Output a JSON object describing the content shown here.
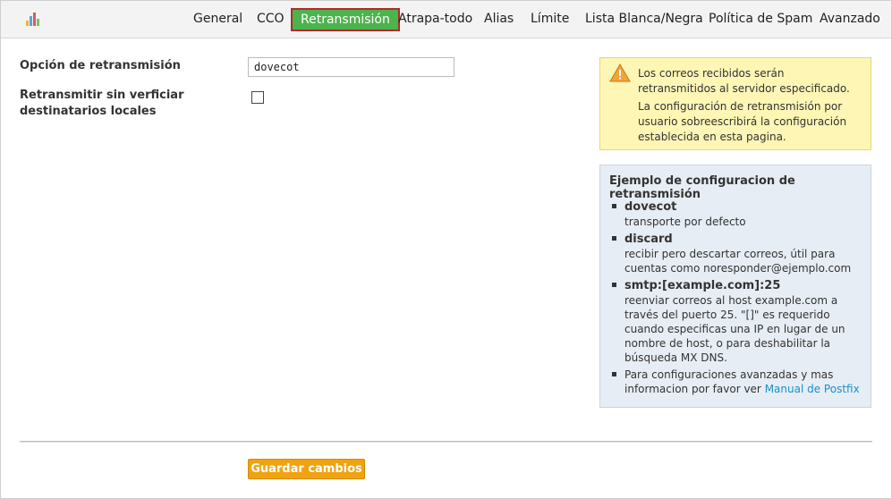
{
  "nav": {
    "tabs": [
      {
        "label": "General"
      },
      {
        "label": "CCO"
      },
      {
        "label": "Retransmisión",
        "active": true
      },
      {
        "label": "Atrapa-todo"
      },
      {
        "label": "Alias"
      },
      {
        "label": "Límite"
      },
      {
        "label": "Lista Blanca/Negra"
      },
      {
        "label": "Política de Spam"
      },
      {
        "label": "Avanzado"
      }
    ]
  },
  "form": {
    "relay_option_label": "Opción de retransmisión",
    "relay_option_value": "dovecot",
    "relay_no_verify_label": "Retransmitir sin verficiar destinatarios locales",
    "relay_no_verify_checked": false
  },
  "warning": {
    "icon": "warning-icon",
    "line1": "Los correos recibidos serán retransmitidos al servidor especificado.",
    "line2": "La configuración de retransmisión por usuario sobreescribirá la configuración establecida en esta pagina."
  },
  "info": {
    "title": "Ejemplo de configuracion de retransmisión",
    "items": [
      {
        "term": "dovecot",
        "desc": "transporte por defecto"
      },
      {
        "term": "discard",
        "desc": "recibir pero descartar correos, útil para cuentas como noresponder@ejemplo.com"
      },
      {
        "term": "smtp:[example.com]:25",
        "desc": "reenviar correos al host example.com a través del puerto 25. \"[]\" es requerido cuando especificas una IP en lugar de un nombre de host, o para deshabilitar la búsqueda MX DNS."
      }
    ],
    "advanced_text": "Para configuraciones avanzadas y mas informacion por favor ver",
    "advanced_link": "Manual de Postfix"
  },
  "actions": {
    "save_label": "Guardar cambios"
  },
  "colors": {
    "active_tab_bg": "#4db34d",
    "active_tab_border": "#b02a2a",
    "save_button": "#f0a20f",
    "warning_bg": "#fdf6b5",
    "info_bg": "#e7edf4",
    "link": "#1a8fc4"
  }
}
